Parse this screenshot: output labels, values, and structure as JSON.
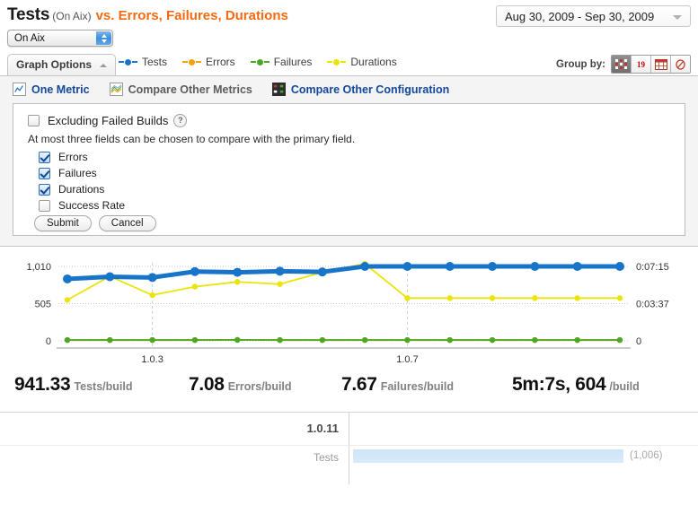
{
  "header": {
    "title_main": "Tests",
    "title_config": "(On Aix)",
    "title_vs": "vs. Errors, Failures, Durations",
    "config_selected": "On Aix",
    "date_range": "Aug 30, 2009 - Sep 30, 2009"
  },
  "tabs": {
    "graph_options": "Graph Options"
  },
  "legend": [
    {
      "label": "Tests",
      "color": "#1874c8"
    },
    {
      "label": "Errors",
      "color": "#f0a30a"
    },
    {
      "label": "Failures",
      "color": "#4aa828"
    },
    {
      "label": "Durations",
      "color": "#eae408"
    }
  ],
  "group_by": {
    "label": "Group by:",
    "buttons": [
      {
        "name": "group-by-build-icon",
        "glyph": "",
        "selected": true
      },
      {
        "name": "group-by-day-icon",
        "glyph": "19",
        "selected": false
      },
      {
        "name": "group-by-week-icon",
        "glyph": "",
        "selected": false
      },
      {
        "name": "group-by-month-icon",
        "glyph": "",
        "selected": false
      }
    ]
  },
  "subtabs": [
    {
      "label": "One Metric",
      "state": "active"
    },
    {
      "label": "Compare Other Metrics",
      "state": "muted"
    },
    {
      "label": "Compare Other Configuration",
      "state": "link"
    }
  ],
  "options": {
    "exclude_label": "Excluding Failed Builds",
    "exclude_checked": false,
    "help_glyph": "?",
    "hint": "At most three fields can be chosen to compare with the primary field.",
    "fields": [
      {
        "label": "Errors",
        "checked": true
      },
      {
        "label": "Failures",
        "checked": true
      },
      {
        "label": "Durations",
        "checked": true
      },
      {
        "label": "Success Rate",
        "checked": false
      }
    ],
    "submit_label": "Submit",
    "cancel_label": "Cancel"
  },
  "chart_data": {
    "type": "line",
    "title": "Tests (On Aix) vs. Errors, Failures, Durations",
    "xlabel": "",
    "ylabel": "",
    "grid": true,
    "legend_position": "top",
    "y_left_ticks": [
      "1,010",
      "505",
      "0"
    ],
    "y_left_values": [
      1010,
      505,
      0
    ],
    "y_right_ticks": [
      "0:07:15",
      "0:03:37",
      "0"
    ],
    "y_right_values": [
      435,
      217,
      0
    ],
    "ylim": [
      0,
      1010
    ],
    "x_tick_labels": [
      "1.0.3",
      "1.0.7"
    ],
    "x_tick_indices": [
      2,
      8
    ],
    "x": [
      0,
      1,
      2,
      3,
      4,
      5,
      6,
      7,
      8,
      9,
      10,
      11,
      12,
      13
    ],
    "series": [
      {
        "name": "Tests",
        "color": "#1874c8",
        "axis": "left",
        "values": [
          840,
          870,
          860,
          940,
          930,
          945,
          935,
          1010,
          1010,
          1010,
          1010,
          1010,
          1010,
          1010
        ]
      },
      {
        "name": "Durations",
        "color": "#eae408",
        "axis": "right",
        "values": [
          555,
          875,
          620,
          735,
          800,
          770,
          930,
          1045,
          580,
          580,
          580,
          580,
          580,
          580
        ]
      },
      {
        "name": "Failures",
        "color": "#4aa828",
        "axis": "left",
        "values": [
          12,
          12,
          12,
          12,
          12,
          12,
          12,
          12,
          12,
          12,
          12,
          12,
          12,
          12
        ]
      },
      {
        "name": "Errors",
        "color": "#f0a30a",
        "axis": "left",
        "values": [
          10,
          10,
          10,
          10,
          14,
          10,
          10,
          10,
          10,
          10,
          10,
          10,
          10,
          10
        ]
      }
    ]
  },
  "stats": [
    {
      "value": "941.33",
      "unit": "Tests/build"
    },
    {
      "value": "7.08",
      "unit": "Errors/build"
    },
    {
      "value": "7.67",
      "unit": "Failures/build"
    },
    {
      "value": "5m:7s, 604",
      "unit": "/build"
    }
  ],
  "bottom": {
    "version": "1.0.11",
    "metric_label": "Tests",
    "bar_value": "(1,006)",
    "bar_fraction": 0.735
  }
}
